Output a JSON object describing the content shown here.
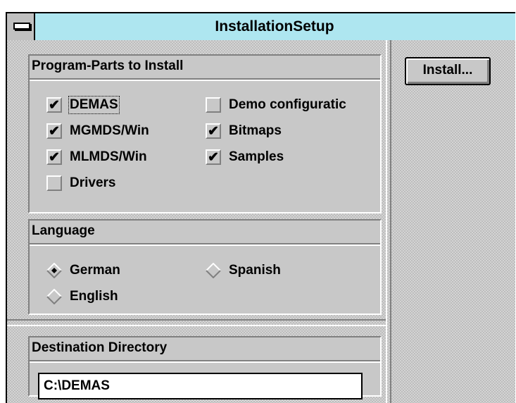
{
  "window": {
    "title": "InstallationSetup"
  },
  "program_parts": {
    "heading": "Program-Parts to Install",
    "items": [
      {
        "label": "DEMAS",
        "checked": true
      },
      {
        "label": "MGMDS/Win",
        "checked": true
      },
      {
        "label": "MLMDS/Win",
        "checked": true
      },
      {
        "label": "Drivers",
        "checked": false
      },
      {
        "label": "Demo configuratic",
        "checked": false
      },
      {
        "label": "Bitmaps",
        "checked": true
      },
      {
        "label": "Samples",
        "checked": true
      }
    ]
  },
  "language": {
    "heading": "Language",
    "options": [
      {
        "label": "German",
        "selected": true
      },
      {
        "label": "English",
        "selected": false
      },
      {
        "label": "Spanish",
        "selected": false
      }
    ]
  },
  "destination": {
    "heading": "Destination Directory",
    "value": "C:\\DEMAS"
  },
  "buttons": {
    "install_label": "Install..."
  }
}
